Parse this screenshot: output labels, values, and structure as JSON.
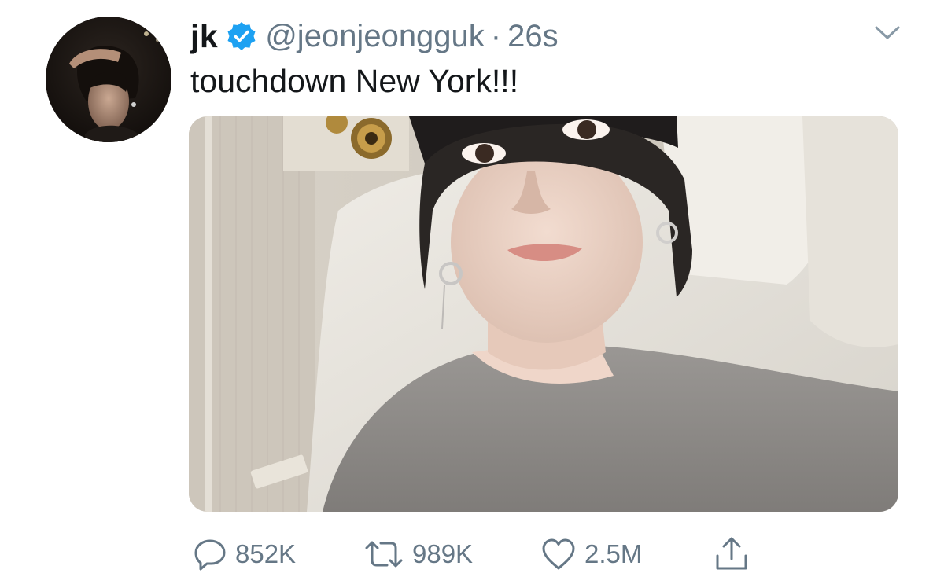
{
  "tweet": {
    "display_name": "jk",
    "verified_icon": "verified-badge-icon",
    "handle": "@jeonjeongguk",
    "separator": "·",
    "timestamp": "26s",
    "text": "touchdown New York!!!",
    "more_icon": "chevron-down-icon"
  },
  "actions": {
    "reply": {
      "icon": "reply-bubble-icon",
      "count": "852K"
    },
    "retweet": {
      "icon": "retweet-icon",
      "count": "989K"
    },
    "like": {
      "icon": "heart-icon",
      "count": "2.5M"
    },
    "share": {
      "icon": "share-upload-icon"
    }
  },
  "colors": {
    "text_primary": "#14171a",
    "text_secondary": "#657786",
    "verified_blue": "#1da1f2",
    "background": "#ffffff"
  }
}
